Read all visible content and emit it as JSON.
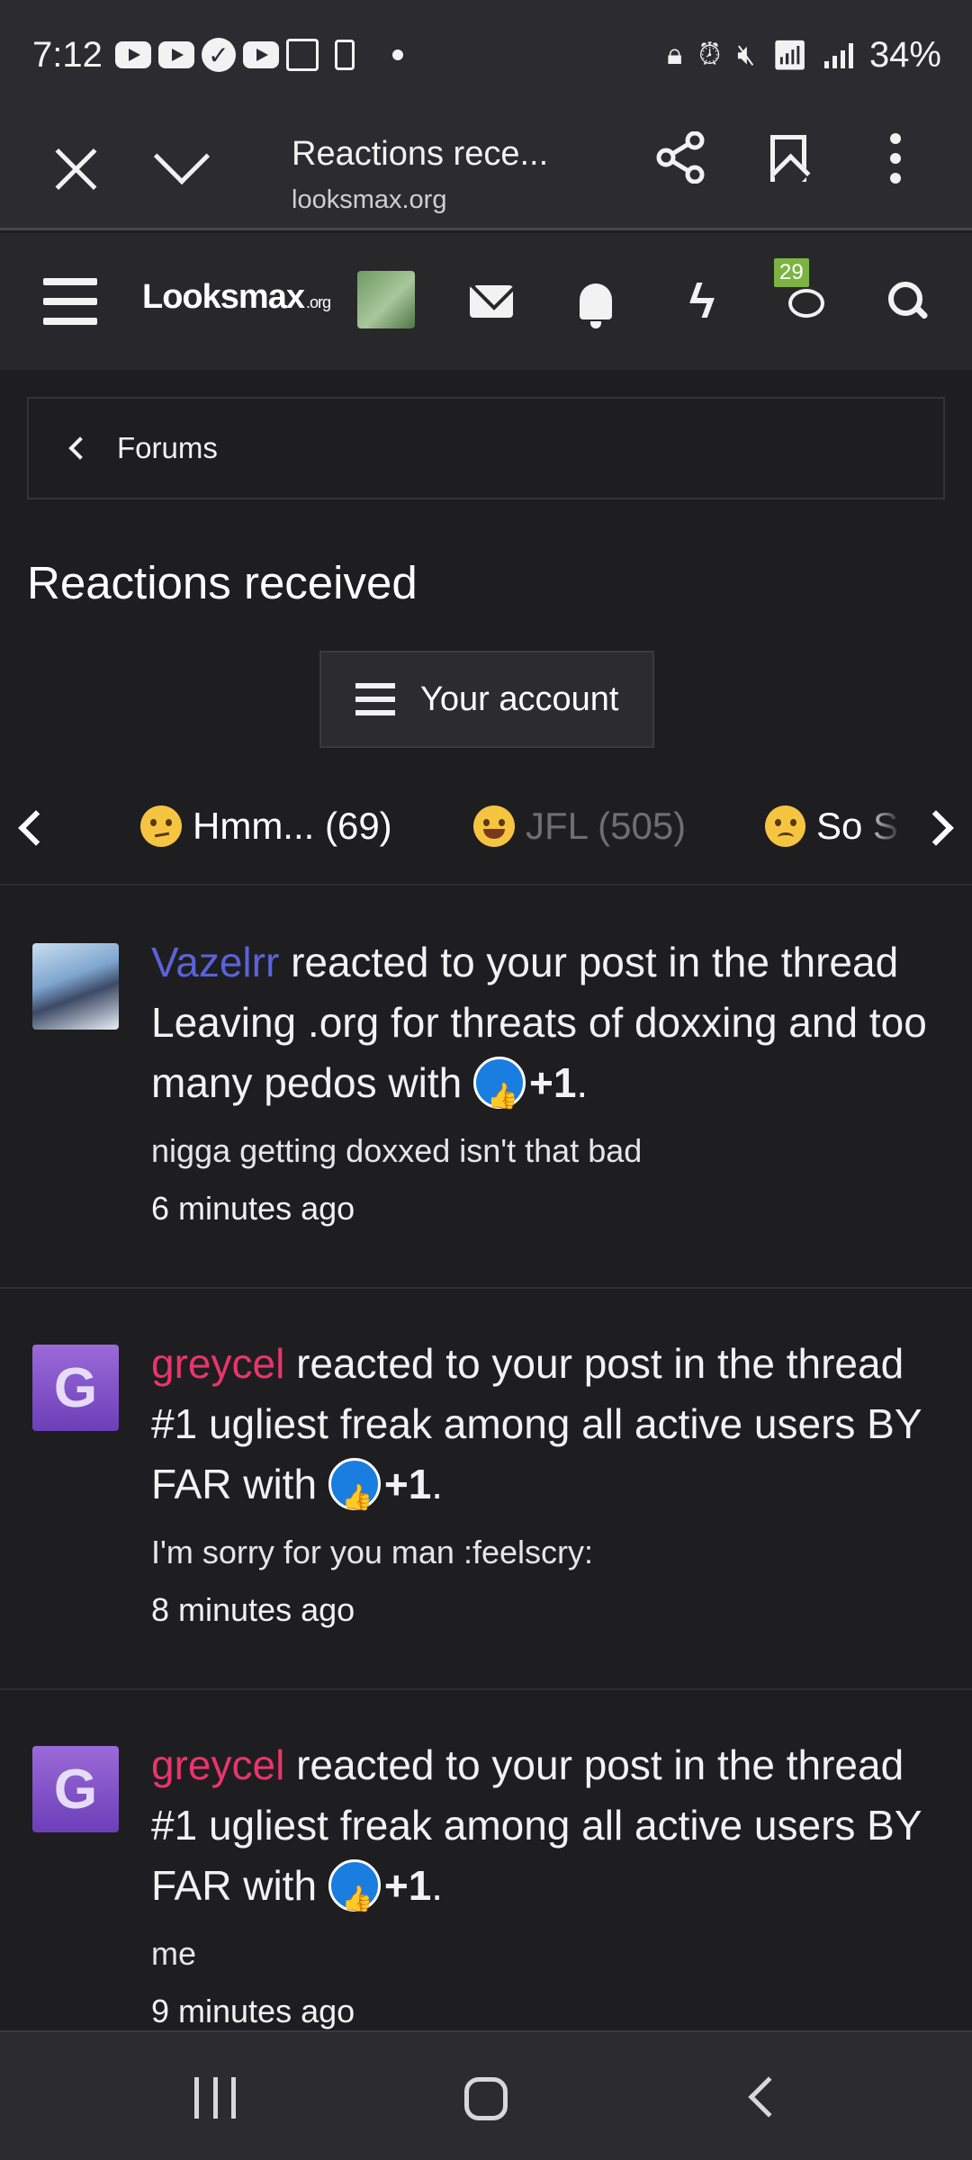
{
  "status_bar": {
    "time": "7:12",
    "battery": "34%"
  },
  "browser": {
    "tab_title": "Reactions rece...",
    "url": "looksmax.org"
  },
  "site_header": {
    "logo": "Looksmax",
    "logo_suffix": ".org",
    "chat_badge": "29"
  },
  "breadcrumb": {
    "label": "Forums"
  },
  "page": {
    "title": "Reactions received",
    "account_button": "Your account"
  },
  "reaction_tabs": [
    {
      "label": "Hmm... (69)"
    },
    {
      "label": "JFL (505)"
    },
    {
      "label": "So S"
    }
  ],
  "feed": [
    {
      "user": "Vazelrr",
      "action": " reacted to your post in the thread Leaving .org for threats of doxxing and too many pedos with ",
      "reaction": "+1",
      "end": ".",
      "snippet": "nigga getting doxxed isn't that bad",
      "time": "6 minutes ago"
    },
    {
      "user": "greycel",
      "avatar_letter": "G",
      "action": " reacted to your post in the thread #1 ugliest freak among all active users BY FAR with ",
      "reaction": "+1",
      "end": ".",
      "snippet": "I'm sorry for you man :feelscry:",
      "time": "8 minutes ago"
    },
    {
      "user": "greycel",
      "avatar_letter": "G",
      "action": " reacted to your post in the thread #1 ugliest freak among all active users BY FAR with ",
      "reaction": "+1",
      "end": ".",
      "snippet": "me",
      "time": "9 minutes ago"
    }
  ]
}
